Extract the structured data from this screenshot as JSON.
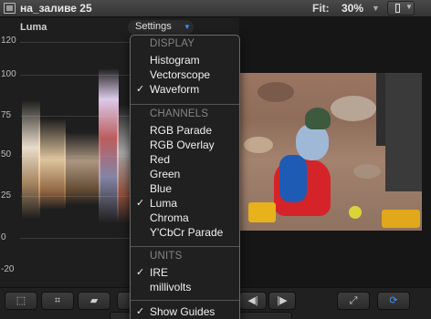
{
  "window": {
    "title": "на_заливе 25",
    "fit_label": "Fit:",
    "fit_value": "30%"
  },
  "scope": {
    "label": "Luma",
    "settings_label": "Settings",
    "axis_labels": [
      "120",
      "100",
      "75",
      "50",
      "25",
      "0",
      "-20"
    ]
  },
  "menu": {
    "display_header": "DISPLAY",
    "histogram": "Histogram",
    "vectorscope": "Vectorscope",
    "waveform": "Waveform",
    "channels_header": "CHANNELS",
    "rgb_parade": "RGB Parade",
    "rgb_overlay": "RGB Overlay",
    "red": "Red",
    "green": "Green",
    "blue": "Blue",
    "luma": "Luma",
    "chroma": "Chroma",
    "ycbcr_parade": "Y'CbCr Parade",
    "units_header": "UNITS",
    "ire": "IRE",
    "millivolts": "millivolts",
    "show_guides": "Show Guides",
    "checkmark": "✓"
  },
  "colors": {
    "accent": "#3f96ff",
    "jacket": "#d4242a"
  },
  "icons": {
    "window": "viewer-window-icon",
    "transform": "transform-icon",
    "crop": "crop-icon",
    "distort": "distort-icon",
    "prev": "previous-frame-icon",
    "next": "next-frame-icon",
    "fullscreen": "fullscreen-icon",
    "loop": "loop-icon"
  }
}
